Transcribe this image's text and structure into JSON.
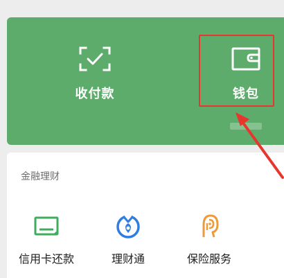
{
  "wallet_panel": {
    "pay_label": "收付款",
    "wallet_label": "钱包"
  },
  "finance": {
    "title": "金融理财",
    "services": [
      {
        "label": "信用卡还款",
        "icon": "credit-card-icon"
      },
      {
        "label": "理财通",
        "icon": "licaitong-icon"
      },
      {
        "label": "保险服务",
        "icon": "insurance-icon"
      }
    ]
  },
  "colors": {
    "panel_green": "#5eac6b",
    "highlight_red": "#e8352d",
    "credit_green": "#3fad5e",
    "licai_blue": "#2f7de1",
    "insure_orange": "#ec9a3c"
  }
}
